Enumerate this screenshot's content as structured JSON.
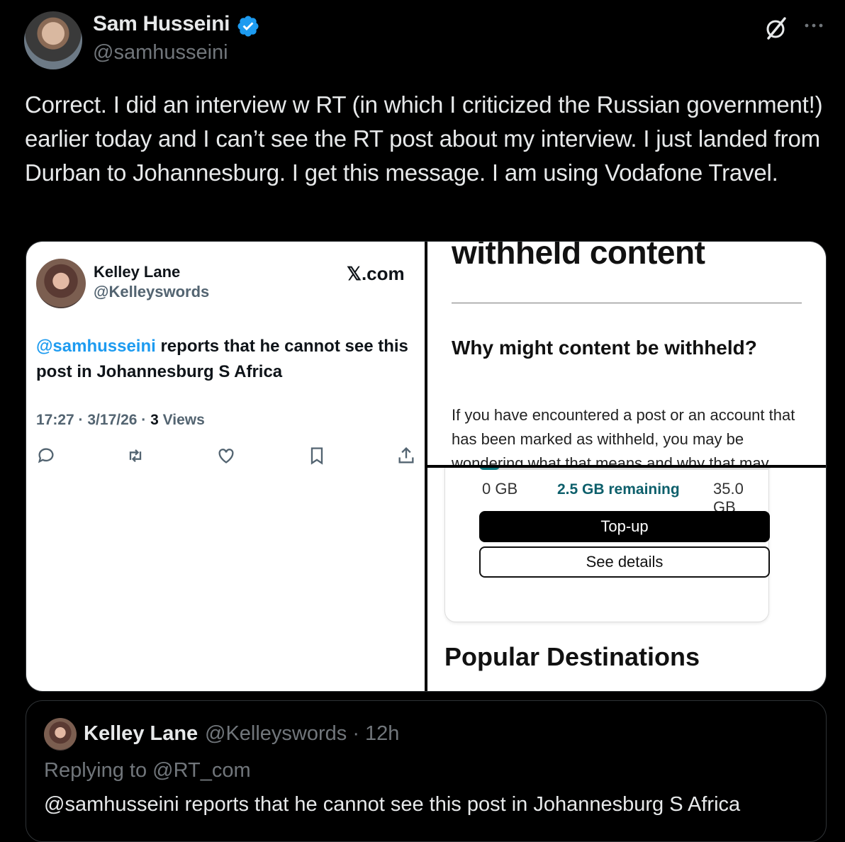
{
  "author": {
    "name": "Sam Husseini",
    "handle": "@samhusseini"
  },
  "tweet": {
    "text": "Correct. I did an interview w RT (in which I criticized the Russian government!) earlier today and I can’t see the RT post about my interview. I just landed from Durban to Johannesburg. I get this message. I am using Vodafone Travel."
  },
  "media": {
    "left": {
      "name": "Kelley Lane",
      "handle": "@Kelleyswords",
      "site": "𝕏.com",
      "mention": "@samhusseini",
      "text": " reports that he cannot see this post in Johannesburg S Africa",
      "time": "17:27 · 3/17/26 · ",
      "views_count": "3",
      "views_label": " Views"
    },
    "top_right": {
      "title": "withheld content",
      "question": "Why might content be withheld?",
      "paragraph": "If you have encountered a post or an account that has been marked as withheld, you may be wondering what that means and why that may"
    },
    "bottom_right": {
      "low": "0 GB",
      "remaining": "2.5 GB remaining",
      "high": "35.0 GB",
      "usage_fraction": 0.07,
      "topup_label": "Top-up",
      "details_label": "See details",
      "popular": "Popular Destinations"
    }
  },
  "quote": {
    "name": "Kelley Lane",
    "handle_time": "@Kelleyswords · 12h",
    "replying": "Replying to @RT_com",
    "text": "@samhusseini reports that he cannot see this post in Johannesburg S Africa"
  },
  "colors": {
    "background": "#000000",
    "link": "#1d9bf0",
    "verified": "#1d9bf0",
    "muted": "#71767b"
  }
}
